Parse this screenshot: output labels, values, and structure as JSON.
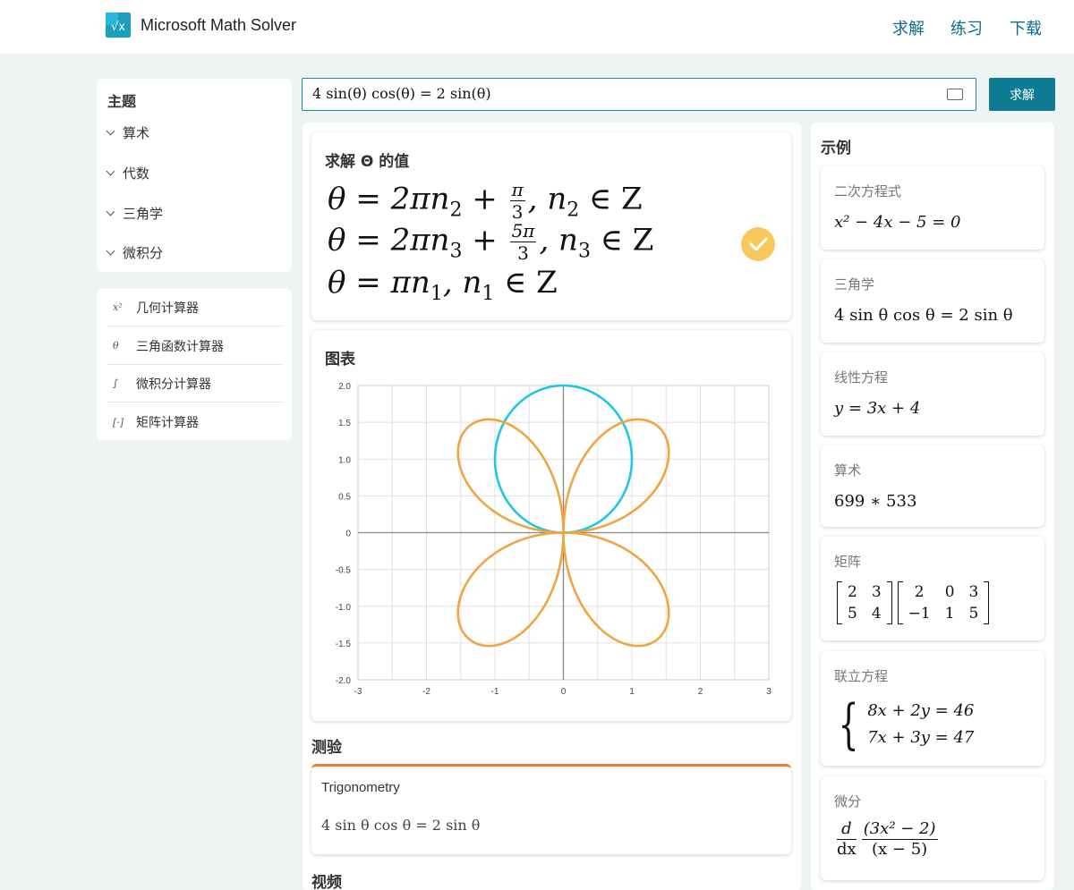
{
  "header": {
    "app_title": "Microsoft Math Solver",
    "nav": [
      "求解",
      "练习",
      "下载"
    ]
  },
  "sidebar": {
    "topics_title": "主题",
    "topics": [
      "算术",
      "代数",
      "三角学",
      "微积分"
    ],
    "calculators": [
      {
        "icon": "geometry-calculator-icon",
        "glyph": "x²",
        "label": "几何计算器"
      },
      {
        "icon": "trig-calculator-icon",
        "glyph": "θ",
        "label": "三角函数计算器"
      },
      {
        "icon": "calculus-calculator-icon",
        "glyph": "∫",
        "label": "微积分计算器"
      },
      {
        "icon": "matrix-calculator-icon",
        "glyph": "[·]",
        "label": "矩阵计算器"
      }
    ]
  },
  "search": {
    "value": "4 sin(θ) cos(θ) = 2 sin(θ)",
    "button_label": "求解"
  },
  "solution": {
    "heading": "求解 Θ 的值",
    "lines": [
      {
        "lhs": "θ = 2πn",
        "sub": "2",
        "frac_num": "π",
        "frac_den": "3",
        "set": ", n",
        "set_sub": "2",
        "tail": " ∈ Z"
      },
      {
        "lhs": "θ = 2πn",
        "sub": "3",
        "frac_num": "5π",
        "frac_den": "3",
        "set": ", n",
        "set_sub": "3",
        "tail": " ∈ Z"
      },
      {
        "lhs": "θ = πn",
        "sub": "1",
        "set": ", n",
        "set_sub": "1",
        "tail": " ∈ Z"
      }
    ],
    "check_color": "#f7c95c"
  },
  "graph": {
    "heading": "图表"
  },
  "chart_data": {
    "type": "line",
    "xlim": [
      -3,
      3
    ],
    "ylim": [
      -2,
      2
    ],
    "x_ticks": [
      "-3",
      "-2",
      "-1",
      "0",
      "1",
      "2",
      "3"
    ],
    "y_ticks": [
      "2.0",
      "1.5",
      "1.0",
      "0.5",
      "0",
      "-0.5",
      "-1.0",
      "-1.5",
      "-2.0"
    ],
    "grid": true,
    "series": [
      {
        "curve": "polar r = 2 sin(θ)",
        "color": "#1ec8e0"
      },
      {
        "curve": "polar r = 4 sin(θ) cos(θ)",
        "color": "#f0a545"
      }
    ]
  },
  "quiz": {
    "title": "测验",
    "subject": "Trigonometry",
    "equation": "4 sin θ cos θ = 2 sin θ",
    "accent": "#f07a2e"
  },
  "video": {
    "title": "视频"
  },
  "examples": {
    "title": "示例",
    "items": [
      {
        "label": "二次方程式"
      },
      {
        "label": "三角学"
      },
      {
        "label": "线性方程"
      },
      {
        "label": "算术"
      },
      {
        "label": "矩阵"
      },
      {
        "label": "联立方程"
      },
      {
        "label": "微分"
      }
    ],
    "quadratic": "x² − 4x − 5 = 0",
    "trig": "4 sin θ cos θ = 2 sin θ",
    "linear": "y = 3x + 4",
    "arith": "699 ∗ 533",
    "matrix_a": [
      [
        "2",
        "3"
      ],
      [
        "5",
        "4"
      ]
    ],
    "matrix_b": [
      [
        "2",
        "0",
        "3"
      ],
      [
        "−1",
        "1",
        "5"
      ]
    ],
    "system": [
      "8x + 2y = 46",
      "7x + 3y = 47"
    ],
    "diff_num": "(3x² − 2)",
    "diff_den": "(x − 5)"
  },
  "colors": {
    "accent": "#0f7b93",
    "nav": "#0f6b8a",
    "background": "#eef4f4"
  }
}
